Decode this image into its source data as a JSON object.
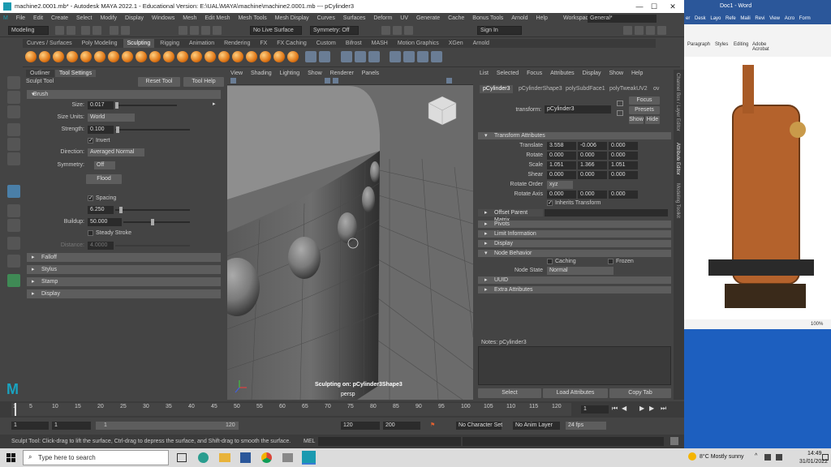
{
  "window": {
    "title": "machine2.0001.mb* - Autodesk MAYA 2022.1 - Educational Version: E:\\UAL\\MAYA\\machine\\machine2.0001.mb  ---  pCylinder3",
    "minimize": "—",
    "maximize": "☐",
    "close": "✕"
  },
  "menubar": {
    "items": [
      "File",
      "Edit",
      "Create",
      "Select",
      "Modify",
      "Display",
      "Windows",
      "Mesh",
      "Edit Mesh",
      "Mesh Tools",
      "Mesh Display",
      "Curves",
      "Surfaces",
      "Deform",
      "UV",
      "Generate",
      "Cache",
      "Bonus Tools",
      "Arnold",
      "Help"
    ],
    "workspace_label": "Workspace:",
    "workspace_value": "General*"
  },
  "statusline": {
    "mode": "Modeling",
    "live_surface": "No Live Surface",
    "symmetry": "Symmetry: Off",
    "sign_in": "Sign In"
  },
  "shelf": {
    "tabs": [
      "Curves / Surfaces",
      "Poly Modeling",
      "Sculpting",
      "Rigging",
      "Animation",
      "Rendering",
      "FX",
      "FX Caching",
      "Custom",
      "Bifrost",
      "MASH",
      "Motion Graphics",
      "XGen",
      "Arnold"
    ],
    "active": "Sculpting"
  },
  "tool_settings": {
    "tabs": [
      "Outliner",
      "Tool Settings"
    ],
    "tool_name": "Sculpt Tool",
    "reset": "Reset Tool",
    "help": "Tool Help",
    "brush_label": "Brush",
    "size_label": "Size:",
    "size": "0.017",
    "size_units_label": "Size Units:",
    "size_units": "World",
    "strength_label": "Strength:",
    "strength": "0.100",
    "invert_label": "Invert",
    "direction_label": "Direction:",
    "direction": "Averaged Normal",
    "symmetry_label": "Symmetry:",
    "symmetry": "Off",
    "flood": "Flood",
    "spacing_label": "Spacing",
    "spacing": "6.250",
    "buildup_label": "Buildup:",
    "buildup": "50.000",
    "steady_label": "Steady Stroke",
    "distance_label": "Distance:",
    "distance": "4.0000",
    "sections": [
      "Falloff",
      "Stylus",
      "Stamp",
      "Display"
    ]
  },
  "viewport": {
    "menu": [
      "View",
      "Shading",
      "Lighting",
      "Show",
      "Renderer",
      "Panels"
    ],
    "hud": "Sculpting on: pCylinder3Shape3",
    "camera": "persp"
  },
  "attribute_editor": {
    "menu": [
      "List",
      "Selected",
      "Focus",
      "Attributes",
      "Display",
      "Show",
      "Help"
    ],
    "node_tabs": [
      "pCylinder3",
      "pCylinderShape3",
      "polySubdFace1",
      "polyTweakUV2",
      "ov"
    ],
    "transform_label": "transform:",
    "transform_value": "pCylinder3",
    "focus": "Focus",
    "presets": "Presets",
    "show": "Show",
    "hide": "Hide",
    "transform_section": "Transform Attributes",
    "rows": [
      {
        "label": "Translate",
        "values": [
          "3.558",
          "-0.006",
          "0.000"
        ]
      },
      {
        "label": "Rotate",
        "values": [
          "0.000",
          "0.000",
          "0.000"
        ]
      },
      {
        "label": "Scale",
        "values": [
          "1.051",
          "1.366",
          "1.051"
        ]
      },
      {
        "label": "Shear",
        "values": [
          "0.000",
          "0.000",
          "0.000"
        ]
      }
    ],
    "rotate_order_label": "Rotate Order",
    "rotate_order": "xyz",
    "rotate_axis_label": "Rotate Axis",
    "rotate_axis": [
      "0.000",
      "0.000",
      "0.000"
    ],
    "inherits": "Inherits Transform",
    "offset_parent": "Offset Parent Matrix",
    "sections": [
      "Pivots",
      "Limit Information",
      "Display"
    ],
    "node_behavior": "Node Behavior",
    "caching": "Caching",
    "frozen": "Frozen",
    "node_state_label": "Node State",
    "node_state": "Normal",
    "sections2": [
      "UUID",
      "Extra Attributes"
    ],
    "notes": "Notes:  pCylinder3",
    "buttons": [
      "Select",
      "Load Attributes",
      "Copy Tab"
    ]
  },
  "side_tabs": [
    "Channel Box / Layer Editor",
    "Attribute Editor",
    "Modeling Toolkit"
  ],
  "timeline": {
    "ticks": [
      "1",
      "5",
      "10",
      "15",
      "20",
      "25",
      "30",
      "35",
      "40",
      "45",
      "50",
      "55",
      "60",
      "65",
      "70",
      "75",
      "80",
      "85",
      "90",
      "95",
      "100",
      "105",
      "110",
      "115",
      "120"
    ],
    "current": "1"
  },
  "range": {
    "start": "1",
    "min": "1",
    "inner_start": "1",
    "inner_end": "120",
    "end": "120",
    "max": "200",
    "character_set": "No Character Set",
    "anim_layer": "No Anim Layer",
    "fps": "24 fps"
  },
  "command": {
    "help": "Sculpt Tool: Click-drag to lift the surface, Ctrl-drag to depress the surface, and Shift-drag to smooth the surface.",
    "mel": "MEL"
  },
  "word": {
    "title": "Doc1 - Word",
    "tabs": [
      "er",
      "Desk",
      "Layo",
      "Refe",
      "Maili",
      "Revi",
      "View",
      "Acro",
      "Form"
    ],
    "groups": [
      "Paragraph",
      "Styles",
      "Editing",
      "Adobe Acrobat"
    ],
    "zoom": "100%"
  },
  "taskbar": {
    "search": "Type here to search",
    "weather": "8°C  Mostly sunny",
    "time": "14:49",
    "date": "31/01/2022"
  }
}
